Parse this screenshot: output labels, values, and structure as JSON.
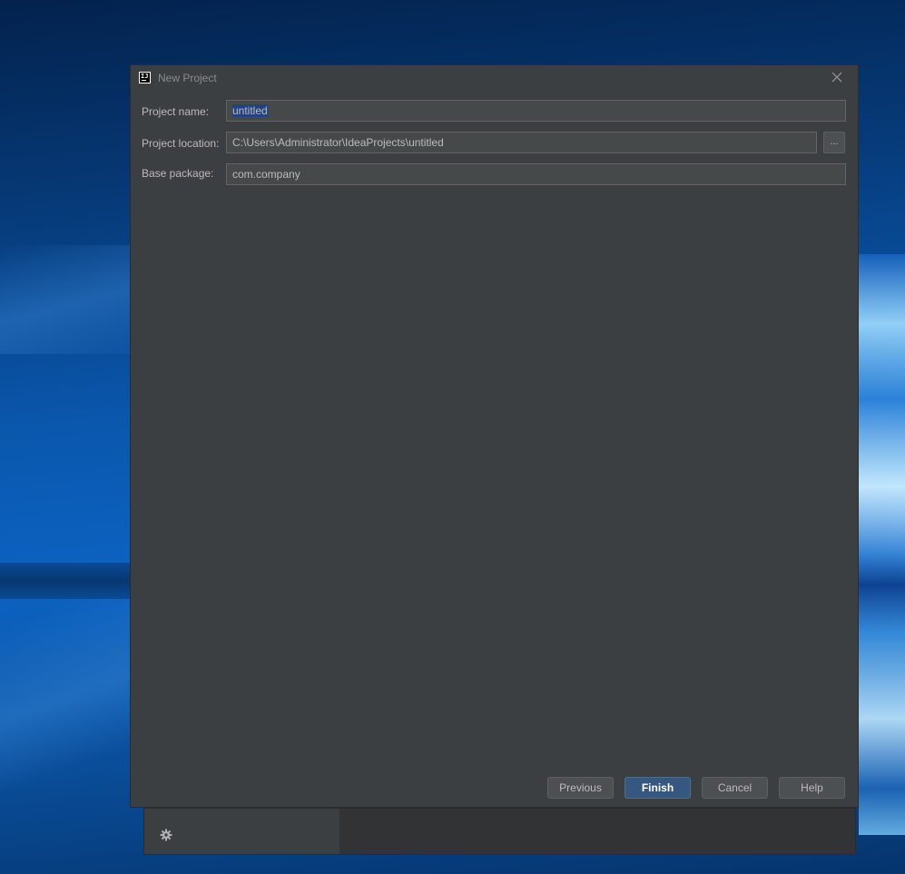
{
  "dialog": {
    "title": "New Project",
    "icon": "intellij-idea-icon"
  },
  "form": {
    "project_name_label": "Project name:",
    "project_name_value": "untitled",
    "project_location_label": "Project location:",
    "project_location_value": "C:\\Users\\Administrator\\IdeaProjects\\untitled",
    "browse_label": "...",
    "base_package_label": "Base package:",
    "base_package_value": "com.company"
  },
  "buttons": {
    "previous": "Previous",
    "finish": "Finish",
    "cancel": "Cancel",
    "help": "Help"
  },
  "background_window": {
    "icon": "gear-icon"
  },
  "colors": {
    "dialog_bg": "#3c3f41",
    "field_bg": "#45494a",
    "selection": "#214283",
    "primary_button": "#365880",
    "desktop_blue": "#0a57ad"
  }
}
